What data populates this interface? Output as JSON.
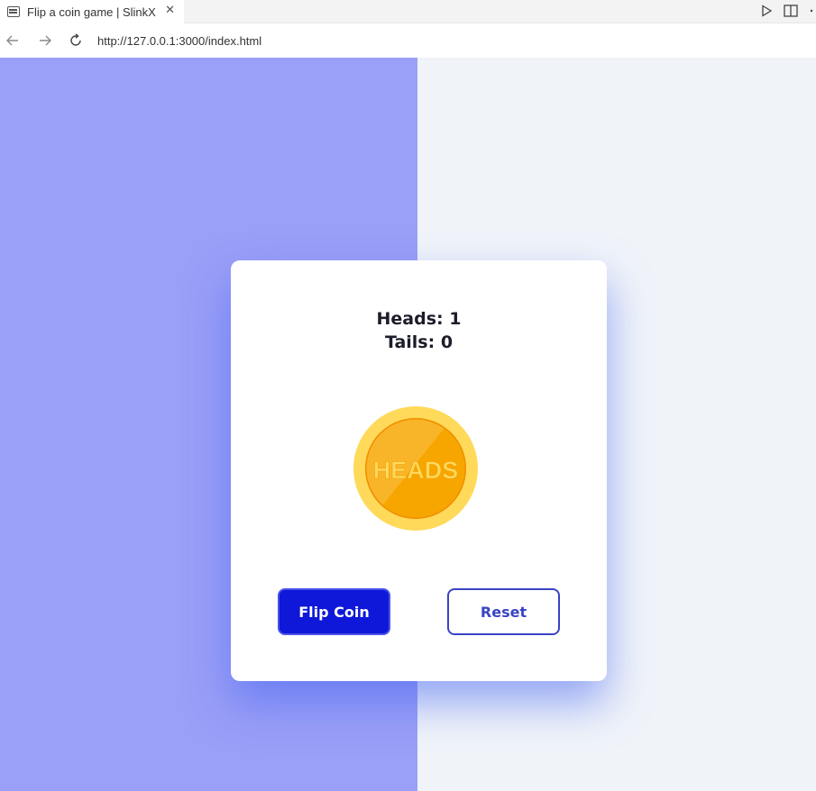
{
  "browser": {
    "tab_title": "Flip a coin game | SlinkX",
    "close_glyph": "✕",
    "url": "http://127.0.0.1:3000/index.html"
  },
  "game": {
    "heads_label": "Heads: 1",
    "tails_label": "Tails: 0",
    "coin_text": "HEADS",
    "flip_button": "Flip Coin",
    "reset_button": "Reset"
  },
  "colors": {
    "left_panel": "#9a9ff7",
    "page_bg": "#f0f4f9",
    "flip_button_bg": "#0f17d9",
    "reset_button_border": "#3a44c4",
    "coin_outer": "#ffd95a",
    "coin_inner": "#f7a600"
  },
  "icons": {
    "tab": "page-icon",
    "back": "arrow-left-icon",
    "forward": "arrow-right-icon",
    "reload": "reload-icon",
    "run": "play-icon",
    "split": "split-editor-icon",
    "more": "more-icon"
  }
}
